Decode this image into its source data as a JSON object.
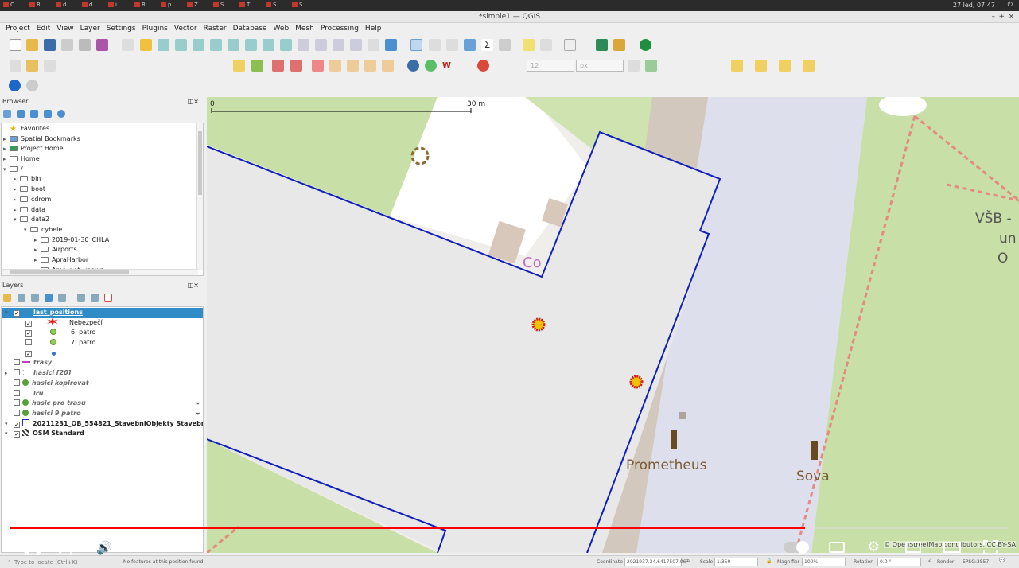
{
  "system": {
    "tabs": [
      "C",
      "R",
      "d...",
      "d...",
      "i...",
      "R...",
      "p...",
      "Z...",
      "S...",
      "T...",
      "S...",
      "S..."
    ],
    "clock": "27 led, 07:47"
  },
  "window": {
    "title": "*simple1 — QGIS",
    "controls": [
      "–",
      "+",
      "×"
    ]
  },
  "menu": [
    "Project",
    "Edit",
    "View",
    "Layer",
    "Settings",
    "Plugins",
    "Vector",
    "Raster",
    "Database",
    "Web",
    "Mesh",
    "Processing",
    "Help"
  ],
  "toolbar2": {
    "size_value": "12",
    "unit_value": "px"
  },
  "browser": {
    "title": "Browser",
    "items": [
      {
        "label": "Favorites",
        "indent": 0,
        "arrow": "",
        "icon": "star"
      },
      {
        "label": "Spatial Bookmarks",
        "indent": 0,
        "arrow": "▸",
        "icon": "bookmark"
      },
      {
        "label": "Project Home",
        "indent": 0,
        "arrow": "▸",
        "icon": "home"
      },
      {
        "label": "Home",
        "indent": 0,
        "arrow": "▸",
        "icon": "folder"
      },
      {
        "label": "/",
        "indent": 0,
        "arrow": "▾",
        "icon": "folder"
      },
      {
        "label": "bin",
        "indent": 1,
        "arrow": "▸",
        "icon": "folder"
      },
      {
        "label": "boot",
        "indent": 1,
        "arrow": "▸",
        "icon": "folder"
      },
      {
        "label": "cdrom",
        "indent": 1,
        "arrow": "▸",
        "icon": "folder"
      },
      {
        "label": "data",
        "indent": 1,
        "arrow": "▸",
        "icon": "folder"
      },
      {
        "label": "data2",
        "indent": 1,
        "arrow": "▾",
        "icon": "folder"
      },
      {
        "label": "cybele",
        "indent": 2,
        "arrow": "▾",
        "icon": "folder"
      },
      {
        "label": "2019-01-30_CHLA",
        "indent": 3,
        "arrow": "▸",
        "icon": "folder"
      },
      {
        "label": "Airports",
        "indent": 3,
        "arrow": "▸",
        "icon": "folder"
      },
      {
        "label": "ApraHarbor",
        "indent": 3,
        "arrow": "▸",
        "icon": "folder"
      },
      {
        "label": "Area_not_known",
        "indent": 3,
        "arrow": "▸",
        "icon": "folder"
      }
    ]
  },
  "layers": {
    "title": "Layers",
    "items": [
      {
        "label": "last_positions",
        "type": "group-selected",
        "checked": true
      },
      {
        "label": "Nebezpečí",
        "type": "symbol-star",
        "checked": true
      },
      {
        "label": "6. patro",
        "type": "symbol-dot",
        "checked": true
      },
      {
        "label": "7. patro",
        "type": "symbol-dot",
        "checked": false
      },
      {
        "label": "",
        "type": "symbol-smalldot",
        "checked": true
      },
      {
        "label": "trasy",
        "type": "line",
        "checked": false
      },
      {
        "label": "hasici [20]",
        "type": "points",
        "checked": false
      },
      {
        "label": "hasici kopirovat",
        "type": "dot",
        "checked": false
      },
      {
        "label": "lru",
        "type": "none",
        "checked": false
      },
      {
        "label": "hasic pro trasu",
        "type": "dot",
        "checked": false
      },
      {
        "label": "hasici 9 patro",
        "type": "dot",
        "checked": false
      },
      {
        "label": "20211231_OB_554821_StavebniObjekty StavebniObjekt",
        "type": "poly",
        "checked": true
      },
      {
        "label": "OSM Standard",
        "type": "raster",
        "checked": true
      }
    ]
  },
  "map": {
    "scalebar_start": "0",
    "scalebar_end": "30 m",
    "labels": {
      "building_partial": "Co",
      "vsb": "VŠB -",
      "vsb2": "un",
      "vsb3": "O",
      "prometheus": "Prometheus",
      "sova": "Sova"
    },
    "attribution": "© OpenStreetMap contributors, CC-BY-SA"
  },
  "player": {
    "time": "1:32 / 1:55",
    "progress": 0.796
  },
  "status": {
    "locate_placeholder": "Type to locate (Ctrl+K)",
    "message": "No features at this position found.",
    "coordinate_label": "Coordinate",
    "coordinate": "2021937.34,6417507.06",
    "scale_label": "Scale",
    "scale": "1:359",
    "magnifier_label": "Magnifier",
    "magnifier": "100%",
    "rotation_label": "Rotation",
    "rotation": "0.0 °",
    "render_label": "Render",
    "crs": "EPSG:3857"
  },
  "colors": {
    "accent": "#308cc6",
    "selection": "#308cc6",
    "building_outline": "#0f1fb8",
    "progress": "#ff0000"
  }
}
